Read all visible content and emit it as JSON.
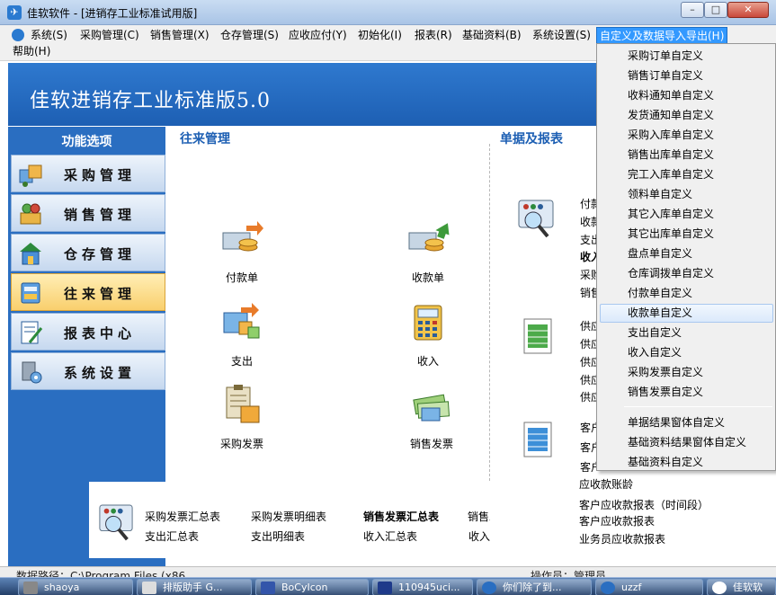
{
  "window": {
    "title": "佳软软件 - [进销存工业标准试用版]",
    "min": "–",
    "max": "□",
    "close": "✕"
  },
  "menubar": {
    "items": [
      "系统(S)",
      "采购管理(C)",
      "销售管理(X)",
      "仓存管理(S)",
      "应收应付(Y)",
      "初始化(I)",
      "报表(R)",
      "基础资料(B)",
      "系统设置(S)",
      "自定义及数据导入导出(H)"
    ],
    "help": "帮助(H)"
  },
  "banner": {
    "app_name": "佳软进销存工业标准版5.0"
  },
  "left": {
    "header": "功能选项",
    "items": [
      {
        "label": "采购管理",
        "icon": "purchase-icon"
      },
      {
        "label": "销售管理",
        "icon": "sales-icon"
      },
      {
        "label": "仓存管理",
        "icon": "warehouse-icon"
      },
      {
        "label": "往来管理",
        "icon": "accounts-icon",
        "active": true
      },
      {
        "label": "报表中心",
        "icon": "report-icon"
      },
      {
        "label": "系统设置",
        "icon": "settings-icon"
      }
    ]
  },
  "main": {
    "section1": "往来管理",
    "section2": "单据及报表",
    "tiles": [
      "付款单",
      "收款单",
      "支出",
      "收入",
      "采购发票",
      "销售发票"
    ]
  },
  "right_links": {
    "group1": [
      "付款",
      "收款",
      "支出",
      "收入",
      "采购",
      "销售"
    ],
    "group2": [
      "供应",
      "供应",
      "供应",
      "供应",
      "供应"
    ],
    "group3": [
      "客户",
      "客户",
      "客户"
    ],
    "lower": [
      "应收款账龄",
      "客户应收款报表（时间段）",
      "客户应收款报表",
      "业务员应收款报表"
    ]
  },
  "summary": {
    "row1": [
      "采购发票汇总表",
      "采购发票明细表",
      "销售发票汇总表",
      "销售发"
    ],
    "row2": [
      "支出汇总表",
      "支出明细表",
      "收入汇总表",
      "收入明"
    ]
  },
  "dropdown": {
    "items": [
      "采购订单自定义",
      "销售订单自定义",
      "收料通知单自定义",
      "发货通知单自定义",
      "采购入库单自定义",
      "销售出库单自定义",
      "完工入库单自定义",
      "领料单自定义",
      "其它入库单自定义",
      "其它出库单自定义",
      "盘点单自定义",
      "仓库调拨单自定义",
      "付款单自定义",
      "收款单自定义",
      "支出自定义",
      "收入自定义",
      "采购发票自定义",
      "销售发票自定义"
    ],
    "items2": [
      "单据结果窗体自定义",
      "基础资料结果窗体自定义",
      "基础资料自定义"
    ],
    "hover_index": 13
  },
  "status": {
    "path": "数据路径：C:\\Program Files (x86",
    "operator": "操作员：管理员"
  },
  "taskbar": {
    "tasks": [
      "shaoya",
      "排版助手 G...",
      "BoCyIcon",
      "110945uci...",
      "你们除了到...",
      "uzzf",
      "佳软软"
    ]
  },
  "colors": {
    "accent": "#1d5fb3",
    "banner": "#2f79cf",
    "active_nav": "#f9cf6d",
    "menu_highlight": "#3399ff"
  }
}
